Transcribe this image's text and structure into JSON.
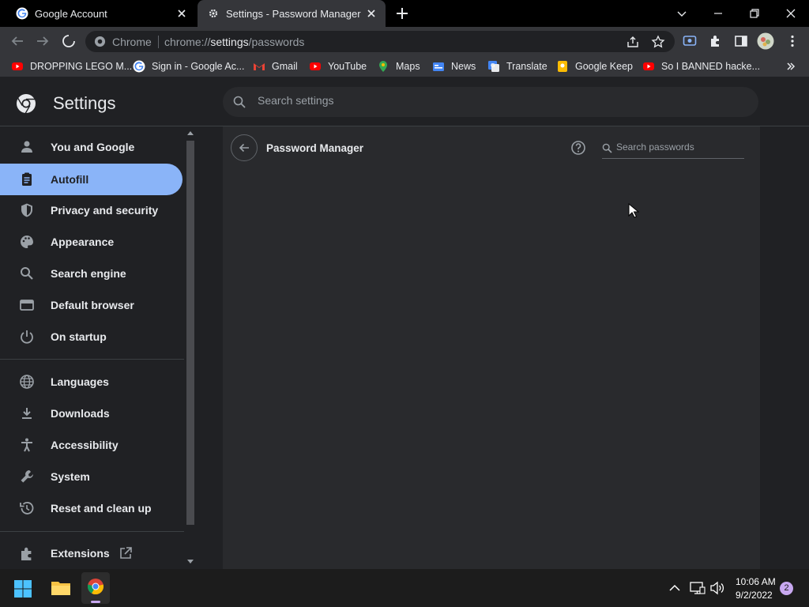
{
  "tabs": [
    {
      "title": "Google Account",
      "icon": "google-g-icon"
    },
    {
      "title": "Settings - Password Manager",
      "icon": "gear-icon",
      "active": true
    }
  ],
  "omnibox": {
    "chip": "Chrome",
    "url_prefix": "chrome://",
    "url_host": "settings",
    "url_path": "/passwords"
  },
  "bookmarks": [
    {
      "label": "DROPPING LEGO M...",
      "icon": "youtube-icon"
    },
    {
      "label": "Sign in - Google Ac...",
      "icon": "google-g-icon"
    },
    {
      "label": "Gmail",
      "icon": "gmail-icon"
    },
    {
      "label": "YouTube",
      "icon": "youtube-icon"
    },
    {
      "label": "Maps",
      "icon": "maps-icon"
    },
    {
      "label": "News",
      "icon": "news-icon"
    },
    {
      "label": "Translate",
      "icon": "translate-icon"
    },
    {
      "label": "Google Keep",
      "icon": "keep-icon"
    },
    {
      "label": "So I BANNED hacke...",
      "icon": "youtube-icon"
    }
  ],
  "settings": {
    "title": "Settings",
    "search_placeholder": "Search settings"
  },
  "sidebar": {
    "items": [
      {
        "label": "You and Google",
        "icon": "person-icon"
      },
      {
        "label": "Autofill",
        "icon": "clipboard-icon",
        "active": true
      },
      {
        "label": "Privacy and security",
        "icon": "shield-icon"
      },
      {
        "label": "Appearance",
        "icon": "palette-icon"
      },
      {
        "label": "Search engine",
        "icon": "search-icon"
      },
      {
        "label": "Default browser",
        "icon": "browser-icon"
      },
      {
        "label": "On startup",
        "icon": "power-icon"
      },
      {
        "label": "Languages",
        "icon": "globe-icon"
      },
      {
        "label": "Downloads",
        "icon": "download-icon"
      },
      {
        "label": "Accessibility",
        "icon": "accessibility-icon"
      },
      {
        "label": "System",
        "icon": "wrench-icon"
      },
      {
        "label": "Reset and clean up",
        "icon": "history-icon"
      },
      {
        "label": "Extensions",
        "icon": "puzzle-icon"
      }
    ]
  },
  "main": {
    "page_title": "Password Manager",
    "search_placeholder": "Search passwords"
  },
  "taskbar": {
    "time": "10:06 AM",
    "date": "9/2/2022",
    "notifications": "2"
  },
  "colors": {
    "accent": "#8ab4f8",
    "background": "#202124",
    "card": "#292a2d",
    "toolbar": "#35363a"
  }
}
